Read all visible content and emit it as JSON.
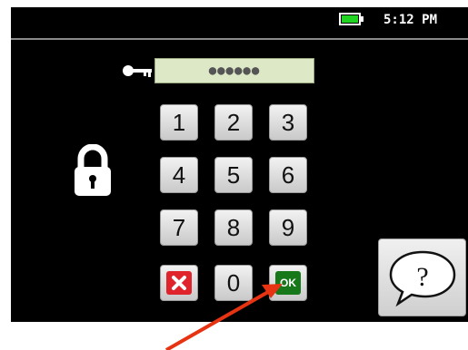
{
  "status_bar": {
    "battery_icon": "battery-full-icon",
    "battery_color": "#22d422",
    "time": "5:12 PM"
  },
  "pin_entry": {
    "key_icon": "key-icon",
    "masked_value": "●●●●●●",
    "field_color": "#dde8c6"
  },
  "lock_icon": "padlock-icon",
  "keypad": {
    "digits": [
      "1",
      "2",
      "3",
      "4",
      "5",
      "6",
      "7",
      "8",
      "9",
      "0"
    ],
    "clear_icon": "delete-x-icon",
    "clear_color": "#e0242b",
    "ok_label": "OK",
    "ok_color": "#17781a"
  },
  "help": {
    "icon": "question-speech-bubble-icon",
    "glyph": "?"
  },
  "annotation": {
    "arrow_icon": "red-arrow-icon",
    "arrow_color": "#e63312"
  }
}
